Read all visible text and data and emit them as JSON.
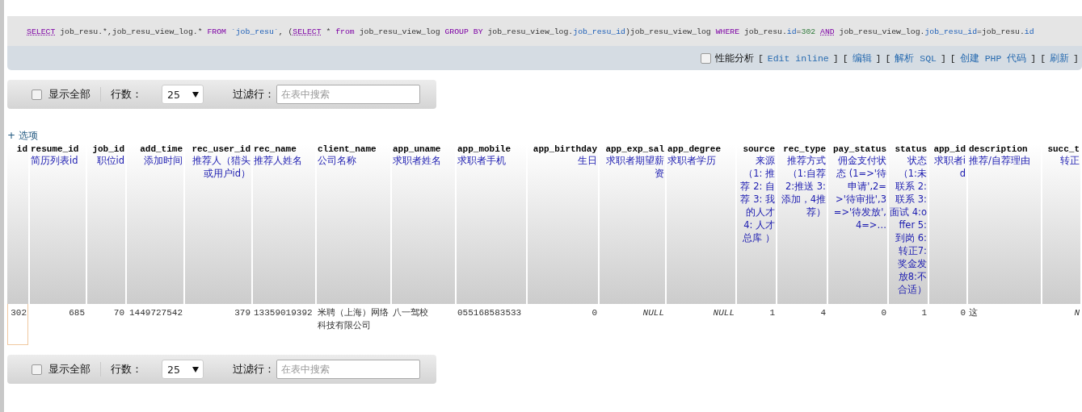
{
  "sql": [
    {
      "kind": "keyword_link",
      "text": "SELECT"
    },
    {
      "kind": "plain",
      "text": " job_resu.*,job_resu_view_log.* "
    },
    {
      "kind": "keyword",
      "text": "FROM"
    },
    {
      "kind": "name",
      "text": " `job_resu`"
    },
    {
      "kind": "plain",
      "text": ", ("
    },
    {
      "kind": "keyword_link",
      "text": "SELECT"
    },
    {
      "kind": "plain",
      "text": " * "
    },
    {
      "kind": "keyword",
      "text": "from"
    },
    {
      "kind": "plain",
      "text": " job_resu_view_log "
    },
    {
      "kind": "keyword",
      "text": "GROUP BY"
    },
    {
      "kind": "plain",
      "text": " job_resu_view_log."
    },
    {
      "kind": "name",
      "text": "job_resu_id"
    },
    {
      "kind": "plain",
      "text": ")job_resu_view_log "
    },
    {
      "kind": "keyword",
      "text": "WHERE"
    },
    {
      "kind": "plain",
      "text": " job_resu."
    },
    {
      "kind": "name",
      "text": "id"
    },
    {
      "kind": "plain",
      "text": "="
    },
    {
      "kind": "number",
      "text": "302"
    },
    {
      "kind": "keyword_link",
      "text": " AND"
    },
    {
      "kind": "plain",
      "text": " job_resu_view_log."
    },
    {
      "kind": "name",
      "text": "job_resu_id"
    },
    {
      "kind": "plain",
      "text": "=job_resu."
    },
    {
      "kind": "name",
      "text": "id"
    }
  ],
  "query_toolbar": {
    "profiling": {
      "label": "性能分析",
      "checked": false
    },
    "items": [
      {
        "kind": "bracket",
        "text": "["
      },
      {
        "kind": "link",
        "text": "Edit inline"
      },
      {
        "kind": "bracket",
        "text": "]"
      },
      {
        "kind": "bracket",
        "text": "["
      },
      {
        "kind": "link",
        "text": "编辑"
      },
      {
        "kind": "bracket",
        "text": "]"
      },
      {
        "kind": "bracket",
        "text": "["
      },
      {
        "kind": "link",
        "text": "解析 SQL"
      },
      {
        "kind": "bracket",
        "text": "]"
      },
      {
        "kind": "bracket",
        "text": "["
      },
      {
        "kind": "link",
        "text": "创建 PHP 代码"
      },
      {
        "kind": "bracket",
        "text": "]"
      },
      {
        "kind": "bracket",
        "text": "["
      },
      {
        "kind": "link",
        "text": "刷新"
      },
      {
        "kind": "bracket",
        "text": "]"
      }
    ]
  },
  "navigation_top": {
    "show_all": {
      "label": "显示全部",
      "checked": false
    },
    "rows_label": "行数：",
    "rows_value": "25",
    "filter_label": "过滤行：",
    "filter_placeholder": "在表中搜索"
  },
  "options_link": "+ 选项",
  "table": {
    "columns": [
      {
        "name": "id",
        "right_aligned": true
      },
      {
        "name": "resume_id",
        "comment": "简历列表id",
        "right_aligned": false
      },
      {
        "name": "job_id",
        "comment": "职位id",
        "right_aligned": true
      },
      {
        "name": "add_time",
        "comment": "添加时间",
        "right_aligned": true
      },
      {
        "name": "rec_user_id",
        "comment": "推荐人（猎头或用户id）",
        "right_aligned": true
      },
      {
        "name": "rec_name",
        "comment": "推荐人姓名",
        "right_aligned": false
      },
      {
        "name": "client_name",
        "comment": "公司名称",
        "right_aligned": false
      },
      {
        "name": "app_uname",
        "comment": "求职者姓名",
        "right_aligned": false
      },
      {
        "name": "app_mobile",
        "comment": "求职者手机",
        "right_aligned": false
      },
      {
        "name": "app_birthday",
        "comment": "生日",
        "right_aligned": true
      },
      {
        "name": "app_exp_sal",
        "comment": "求职者期望薪资",
        "right_aligned": true
      },
      {
        "name": "app_degree",
        "comment": "求职者学历",
        "right_aligned": false
      },
      {
        "name": "source",
        "comment": "来源（1: 推荐 2: 自荐 3: 我的人才 4: 人才总库 ）",
        "right_aligned": true
      },
      {
        "name": "rec_type",
        "comment": "推荐方式（1:自荐 2:推送 3:添加，4推荐）",
        "right_aligned": true
      },
      {
        "name": "pay_status",
        "comment": "佣金支付状态 (1=>'待申请',2=>'待审批',3=>'待发放',4=>…",
        "right_aligned": true
      },
      {
        "name": "status",
        "comment": "状态（1:未联系 2:联系 3:面试 4:offer 5: 到岗 6:转正7:奖金发放8:不合适）",
        "right_aligned": true
      },
      {
        "name": "app_id",
        "comment": "求职者id",
        "right_aligned": true
      },
      {
        "name": "description",
        "comment": "推荐/自荐理由",
        "right_aligned": false
      },
      {
        "name": "succ_t",
        "comment": "转正",
        "right_aligned": true
      }
    ],
    "rows": [
      {
        "selected": false,
        "cells": [
          {
            "value": "302",
            "null": false
          },
          {
            "value": "685",
            "null": false
          },
          {
            "value": "70",
            "null": false
          },
          {
            "value": "1449727542",
            "null": false
          },
          {
            "value": "379",
            "null": false
          },
          {
            "value": "13359019392",
            "null": false
          },
          {
            "value": "米聘（上海）网络科技有限公司",
            "null": false
          },
          {
            "value": "八一驾校",
            "null": false
          },
          {
            "value": "055168583533",
            "null": false
          },
          {
            "value": "0",
            "null": false
          },
          {
            "value": "NULL",
            "null": true
          },
          {
            "value": "NULL",
            "null": true
          },
          {
            "value": "1",
            "null": false
          },
          {
            "value": "4",
            "null": false
          },
          {
            "value": "0",
            "null": false
          },
          {
            "value": "1",
            "null": false
          },
          {
            "value": "0",
            "null": false
          },
          {
            "value": "这",
            "null": false
          },
          {
            "value": "N",
            "null": true
          }
        ]
      }
    ]
  },
  "navigation_bottom": {
    "show_all": {
      "label": "显示全部",
      "checked": false
    },
    "rows_label": "行数：",
    "rows_value": "25",
    "filter_label": "过滤行：",
    "filter_placeholder": "在表中搜索"
  }
}
